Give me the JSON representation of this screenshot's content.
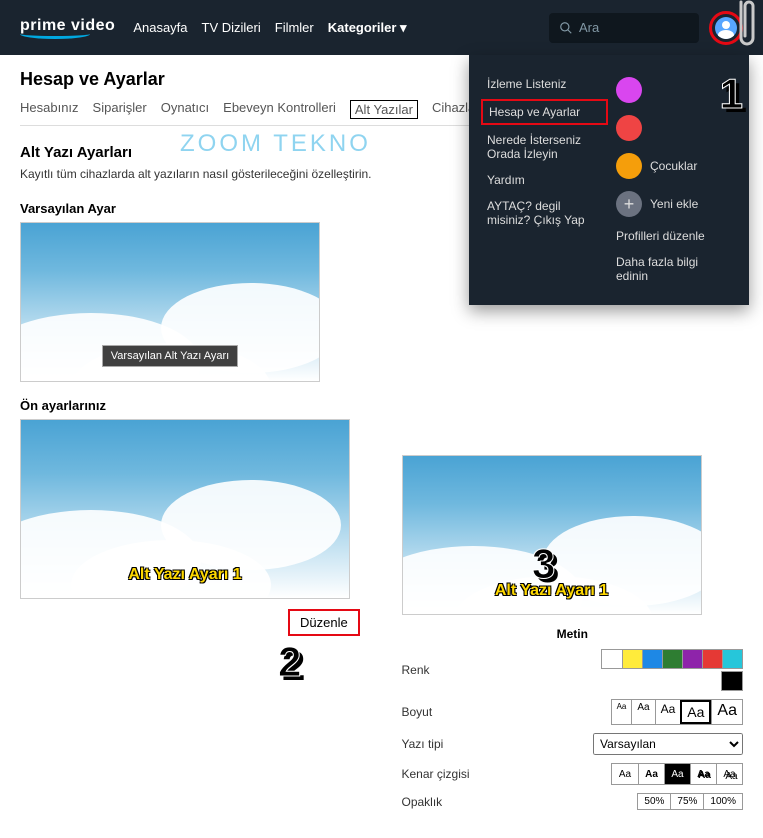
{
  "header": {
    "logo": "prime video",
    "nav": [
      "Anasayfa",
      "TV Dizileri",
      "Filmler",
      "Kategoriler"
    ],
    "search_placeholder": "Ara"
  },
  "page": {
    "title": "Hesap ve Ayarlar",
    "tabs": [
      "Hesabınız",
      "Siparişler",
      "Oynatıcı",
      "Ebeveyn Kontrolleri",
      "Alt Yazılar",
      "Cihazların"
    ],
    "active_tab": "Alt Yazılar",
    "section_title": "Alt Yazı Ayarları",
    "section_desc": "Kayıtlı tüm cihazlarda alt yazıların nasıl gösterileceğini özelleştirin.",
    "default_label": "Varsayılan Ayar",
    "presets_label": "Ön ayarlarınız",
    "caption_default": "Varsayılan Alt Yazı Ayarı",
    "caption_preset1": "Alt Yazı Ayarı 1",
    "edit": "Düzenle"
  },
  "dropdown": {
    "left": [
      "İzleme Listeniz",
      "Hesap ve Ayarlar",
      "Nerede İsterseniz Orada İzleyin",
      "Yardım",
      "AYTAÇ? degil misiniz? Çıkış Yap"
    ],
    "profiles": [
      {
        "name": "",
        "color": "p-pink"
      },
      {
        "name": "",
        "color": "p-red"
      },
      {
        "name": "Çocuklar",
        "color": "p-orange"
      },
      {
        "name": "Yeni ekle",
        "color": "p-grey",
        "plus": "+"
      }
    ],
    "right_links": [
      "Profilleri düzenle",
      "Daha fazla bilgi edinin"
    ]
  },
  "controls": {
    "header": "Metin",
    "rows": {
      "color": "Renk",
      "size": "Boyut",
      "font": "Yazı tipi",
      "edge": "Kenar çizgisi",
      "opacity": "Opaklık"
    },
    "colors": [
      "#ffffff",
      "#ffeb3b",
      "#1e88e5",
      "#2e7d32",
      "#8e24aa",
      "#e53935",
      "#26c6da",
      "#000000"
    ],
    "sizes": [
      "Aa",
      "Aa",
      "Aa",
      "Aa",
      "Aa"
    ],
    "font_options": [
      "Varsayılan"
    ],
    "opacity": [
      "50%",
      "75%",
      "100%"
    ]
  },
  "markers": {
    "m1": "1",
    "m2": "2",
    "m3": "3"
  },
  "watermark": "ZOOM TEKNO"
}
